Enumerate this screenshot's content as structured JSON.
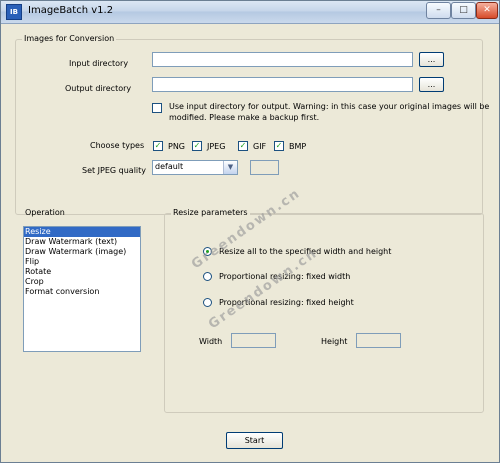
{
  "window": {
    "title": "ImageBatch v1.2",
    "app_icon_text": "IB",
    "minimize_symbol": "–",
    "maximize_symbol": "□",
    "close_symbol": "✕"
  },
  "images_group": {
    "legend": "Images for Conversion",
    "input_directory_label": "Input directory",
    "input_directory_value": "",
    "output_directory_label": "Output directory",
    "output_directory_value": "",
    "browse_label": "...",
    "use_input_dir_line1": "Use input directory for output. Warning: in this case your original images will be",
    "use_input_dir_line2": "modified. Please make a backup first.",
    "choose_types_label": "Choose types",
    "types": [
      "PNG",
      "JPEG",
      "GIF",
      "BMP"
    ],
    "check_mark": "✓",
    "jpeg_quality_label": "Set JPEG quality",
    "jpeg_quality_selected": "default",
    "dropdown_symbol": "▼"
  },
  "operation": {
    "label": "Operation",
    "items": [
      "Resize",
      "Draw Watermark (text)",
      "Draw Watermark (image)",
      "Flip",
      "Rotate",
      "Crop",
      "Format conversion"
    ]
  },
  "resize": {
    "legend": "Resize parameters",
    "option1": "Resize all to the specified width and height",
    "option2": "Proportional resizing: fixed width",
    "option3": "Proportional resizing: fixed height",
    "width_label": "Width",
    "height_label": "Height"
  },
  "start_button": "Start",
  "watermark_text": "Greendown.cn"
}
